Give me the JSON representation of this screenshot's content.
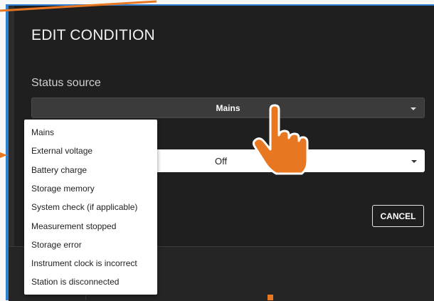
{
  "dialog": {
    "title": "EDIT CONDITION",
    "status_source_label": "Status source",
    "status_source_value": "Mains",
    "second_select_value": "Off",
    "cancel_label": "CANCEL"
  },
  "dropdown": {
    "options": [
      "Mains",
      "External voltage",
      "Battery charge",
      "Storage memory",
      "System check (if applicable)",
      "Measurement stopped",
      "Storage error",
      "Instrument clock is incorrect",
      "Station is disconnected"
    ]
  },
  "colors": {
    "annotation": "#e87722",
    "frame_accent": "#2f7fd3",
    "dialog_bg": "#1f1f1f"
  },
  "icons": {
    "pointer": "pointing-hand-icon",
    "caret": "chevron-down-icon"
  }
}
